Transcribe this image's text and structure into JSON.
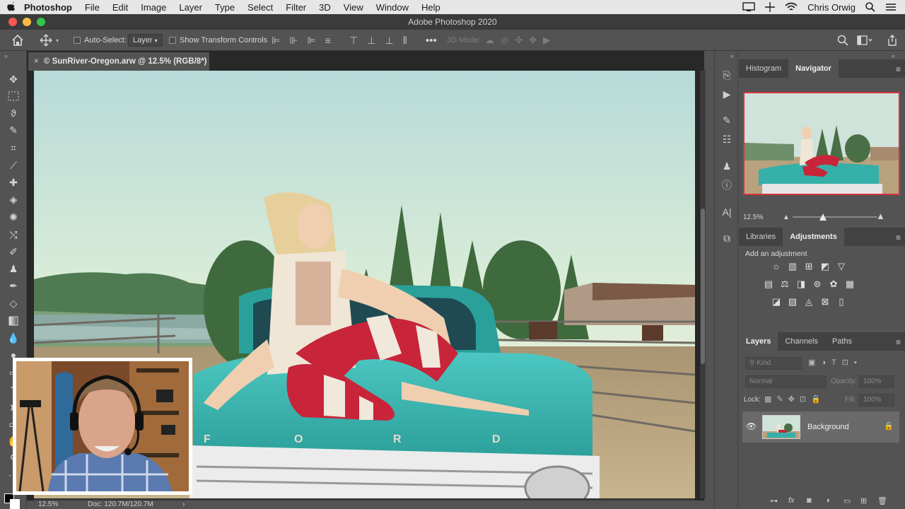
{
  "menubar": {
    "apple": "",
    "app_name": "Photoshop",
    "items": [
      "File",
      "Edit",
      "Image",
      "Layer",
      "Type",
      "Select",
      "Filter",
      "3D",
      "View",
      "Window",
      "Help"
    ],
    "user": "Chris Orwig"
  },
  "window": {
    "title": "Adobe Photoshop 2020"
  },
  "options_bar": {
    "auto_select_label": "Auto-Select:",
    "auto_select_value": "Layer",
    "transform_label": "Show Transform Controls",
    "mode_label": "3D Mode:"
  },
  "document": {
    "tab_title": "© SunRiver-Oregon.arw @ 12.5% (RGB/8*)",
    "status_zoom": "12.5%",
    "status_doc": "Doc: 120.7M/120.7M",
    "photo_letters": [
      "F",
      "O",
      "R",
      "D"
    ]
  },
  "panels": {
    "top_tabs": [
      "Histogram",
      "Navigator"
    ],
    "navigator_zoom": "12.5%",
    "mid_tabs": [
      "Libraries",
      "Adjustments"
    ],
    "add_adjustment": "Add an adjustment",
    "layer_tabs": [
      "Layers",
      "Channels",
      "Paths"
    ],
    "kind_placeholder": "Kind",
    "blend_mode": "Normal",
    "opacity_label": "Opacity:",
    "opacity_value": "100%",
    "lock_label": "Lock:",
    "fill_label": "Fill:",
    "fill_value": "100%",
    "layer_name": "Background"
  },
  "colors": {
    "panel": "#535353",
    "dark": "#424242",
    "navigator_frame": "#d8323c",
    "truck": "#3fb5b0"
  }
}
